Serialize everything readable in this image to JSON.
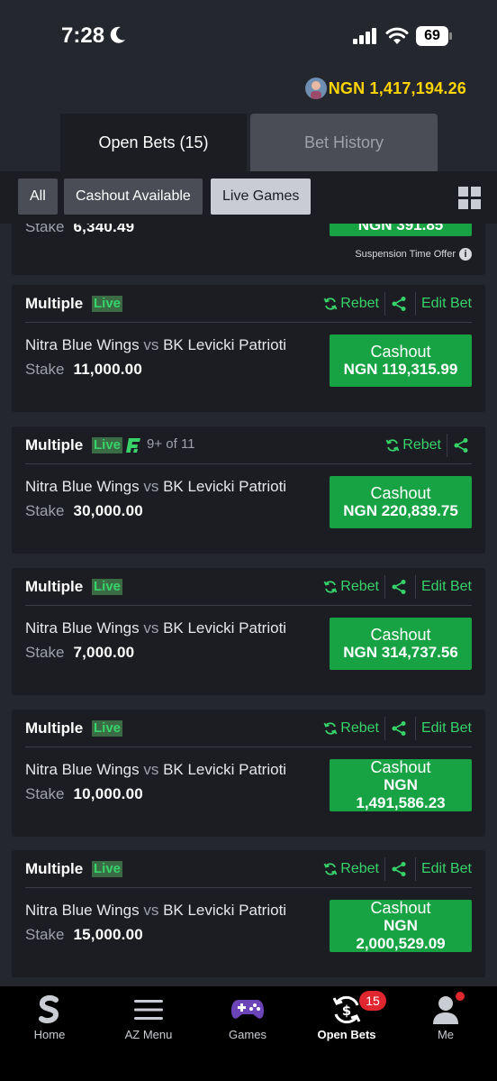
{
  "status_bar": {
    "time": "7:28",
    "battery": "69"
  },
  "account": {
    "balance": "NGN 1,417,194.26"
  },
  "tabs": [
    {
      "label": "Open Bets (15)"
    },
    {
      "label": "Bet History"
    }
  ],
  "filters": [
    {
      "label": "All"
    },
    {
      "label": "Cashout Available"
    },
    {
      "label": "Live Games"
    }
  ],
  "partial_card": {
    "stake_label": "Stake",
    "stake": "6,340.49",
    "cashout_amount": "NGN 391.85",
    "suspension_text": "Suspension Time Offer"
  },
  "actions": {
    "rebet": "Rebet",
    "edit_bet": "Edit Bet"
  },
  "bets": [
    {
      "type": "Multiple",
      "live": "Live",
      "home": "Nitra Blue Wings",
      "vs": "vs",
      "away": "BK Levicki Patrioti",
      "stake_label": "Stake",
      "stake": "11,000.00",
      "cashout_label": "Cashout",
      "cashout_amount": "NGN 119,315.99"
    },
    {
      "type": "Multiple",
      "live": "Live",
      "legs": "9+ of 11",
      "home": "Nitra Blue Wings",
      "vs": "vs",
      "away": "BK Levicki Patrioti",
      "stake_label": "Stake",
      "stake": "30,000.00",
      "cashout_label": "Cashout",
      "cashout_amount": "NGN 220,839.75"
    },
    {
      "type": "Multiple",
      "live": "Live",
      "home": "Nitra Blue Wings",
      "vs": "vs",
      "away": "BK Levicki Patrioti",
      "stake_label": "Stake",
      "stake": "7,000.00",
      "cashout_label": "Cashout",
      "cashout_amount": "NGN 314,737.56"
    },
    {
      "type": "Multiple",
      "live": "Live",
      "home": "Nitra Blue Wings",
      "vs": "vs",
      "away": "BK Levicki Patrioti",
      "stake_label": "Stake",
      "stake": "10,000.00",
      "cashout_label": "Cashout",
      "cashout_currency": "NGN",
      "cashout_value": "1,491,586.23"
    },
    {
      "type": "Multiple",
      "live": "Live",
      "home": "Nitra Blue Wings",
      "vs": "vs",
      "away": "BK Levicki Patrioti",
      "stake_label": "Stake",
      "stake": "15,000.00",
      "cashout_label": "Cashout",
      "cashout_currency": "NGN",
      "cashout_value": "2,000,529.09"
    }
  ],
  "bottom_nav": [
    {
      "label": "Home",
      "icon": "sportybet-logo-icon"
    },
    {
      "label": "AZ Menu",
      "icon": "hamburger-icon"
    },
    {
      "label": "Games",
      "icon": "gamepad-icon"
    },
    {
      "label": "Open Bets",
      "icon": "cashout-cycle-icon",
      "badge": "15"
    },
    {
      "label": "Me",
      "icon": "user-icon"
    }
  ],
  "colors": {
    "accent_green": "#37d36a",
    "cashout_green": "#17a344",
    "balance_yellow": "#ffd400",
    "badge_red": "#e0262f"
  }
}
